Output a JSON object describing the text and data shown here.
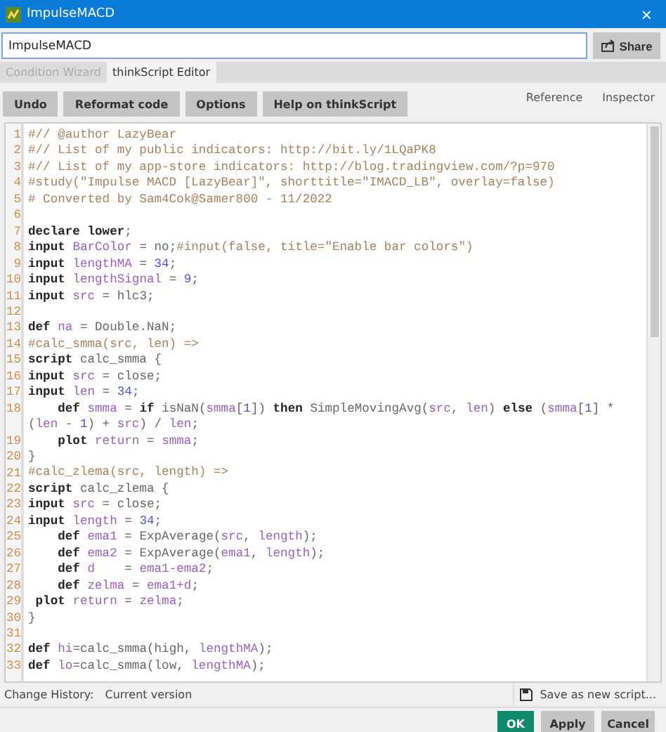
{
  "window": {
    "title": "ImpulseMACD",
    "close": "×"
  },
  "name_field": {
    "value": "ImpulseMACD"
  },
  "share_button": {
    "label": "Share"
  },
  "tabs": [
    {
      "label": "Condition Wizard",
      "selected": false
    },
    {
      "label": "thinkScript Editor",
      "selected": true
    }
  ],
  "toolbar": {
    "buttons": [
      "Undo",
      "Reformat code",
      "Options",
      "Help on thinkScript"
    ],
    "links": [
      "Reference",
      "Inspector"
    ]
  },
  "editor": {
    "lines": [
      {
        "number": "1",
        "tokens": [
          {
            "kind": "comment",
            "text": "#// @author LazyBear"
          }
        ]
      },
      {
        "number": "2",
        "tokens": [
          {
            "kind": "comment",
            "text": "#// List of my public indicators: http://bit.ly/1LQaPK8"
          }
        ]
      },
      {
        "number": "3",
        "tokens": [
          {
            "kind": "comment",
            "text": "#// List of my app-store indicators: http://blog.tradingview.com/?p=970"
          }
        ]
      },
      {
        "number": "4",
        "tokens": [
          {
            "kind": "comment",
            "text": "#study(\"Impulse MACD [LazyBear]\", shorttitle=\"IMACD_LB\", overlay=false)"
          }
        ]
      },
      {
        "number": "5",
        "tokens": [
          {
            "kind": "comment",
            "text": "# Converted by Sam4Cok@Samer800 - 11/2022"
          }
        ]
      },
      {
        "number": "6"
      },
      {
        "number": "7",
        "tokens": [
          {
            "kind": "keyword",
            "text": "declare lower"
          },
          {
            "kind": "plain",
            "text": ";"
          }
        ]
      },
      {
        "number": "8",
        "tokens": [
          {
            "kind": "keyword",
            "text": "input "
          },
          {
            "kind": "ident",
            "text": "BarColor"
          },
          {
            "kind": "plain",
            "text": " = no;"
          },
          {
            "kind": "comment",
            "text": "#input(false, title=\"Enable bar colors\")"
          }
        ]
      },
      {
        "number": "9",
        "tokens": [
          {
            "kind": "keyword",
            "text": "input "
          },
          {
            "kind": "ident",
            "text": "lengthMA"
          },
          {
            "kind": "plain",
            "text": " = "
          },
          {
            "kind": "number",
            "text": "34"
          },
          {
            "kind": "plain",
            "text": ";"
          }
        ]
      },
      {
        "number": "10",
        "tokens": [
          {
            "kind": "keyword",
            "text": "input "
          },
          {
            "kind": "ident",
            "text": "lengthSignal"
          },
          {
            "kind": "plain",
            "text": " = "
          },
          {
            "kind": "number",
            "text": "9"
          },
          {
            "kind": "plain",
            "text": ";"
          }
        ]
      },
      {
        "number": "11",
        "tokens": [
          {
            "kind": "keyword",
            "text": "input "
          },
          {
            "kind": "ident",
            "text": "src"
          },
          {
            "kind": "plain",
            "text": " = hlc3;"
          }
        ]
      },
      {
        "number": "12"
      },
      {
        "number": "13",
        "tokens": [
          {
            "kind": "keyword",
            "text": "def "
          },
          {
            "kind": "ident",
            "text": "na"
          },
          {
            "kind": "plain",
            "text": " = Double.NaN;"
          }
        ]
      },
      {
        "number": "14",
        "tokens": [
          {
            "kind": "comment",
            "text": "#calc_smma(src, len) =>"
          }
        ]
      },
      {
        "number": "15",
        "tokens": [
          {
            "kind": "keyword",
            "text": "script "
          },
          {
            "kind": "plain",
            "text": "calc_smma {"
          }
        ]
      },
      {
        "number": "16",
        "tokens": [
          {
            "kind": "keyword",
            "text": "input "
          },
          {
            "kind": "ident",
            "text": "src"
          },
          {
            "kind": "plain",
            "text": " = close;"
          }
        ]
      },
      {
        "number": "17",
        "tokens": [
          {
            "kind": "keyword",
            "text": "input "
          },
          {
            "kind": "ident",
            "text": "len"
          },
          {
            "kind": "plain",
            "text": " = "
          },
          {
            "kind": "number",
            "text": "34"
          },
          {
            "kind": "plain",
            "text": ";"
          }
        ]
      },
      {
        "number": "18",
        "tokens": [
          {
            "kind": "keyword",
            "text": "    def "
          },
          {
            "kind": "ident",
            "text": "smma"
          },
          {
            "kind": "plain",
            "text": " = "
          },
          {
            "kind": "keyword",
            "text": "if "
          },
          {
            "kind": "plain",
            "text": "isNaN("
          },
          {
            "kind": "ident",
            "text": "smma"
          },
          {
            "kind": "plain",
            "text": "["
          },
          {
            "kind": "number",
            "text": "1"
          },
          {
            "kind": "plain",
            "text": "]) "
          },
          {
            "kind": "keyword",
            "text": "then "
          },
          {
            "kind": "plain",
            "text": "SimpleMovingAvg("
          },
          {
            "kind": "ident",
            "text": "src"
          },
          {
            "kind": "plain",
            "text": ", "
          },
          {
            "kind": "ident",
            "text": "len"
          },
          {
            "kind": "plain",
            "text": ") "
          },
          {
            "kind": "keyword",
            "text": "else "
          },
          {
            "kind": "plain",
            "text": "("
          },
          {
            "kind": "ident",
            "text": "smma"
          },
          {
            "kind": "plain",
            "text": "["
          },
          {
            "kind": "number",
            "text": "1"
          },
          {
            "kind": "plain",
            "text": "] * ("
          },
          {
            "kind": "ident",
            "text": "len"
          },
          {
            "kind": "plain",
            "text": " - "
          },
          {
            "kind": "number",
            "text": "1"
          },
          {
            "kind": "plain",
            "text": ") + "
          },
          {
            "kind": "ident",
            "text": "src"
          },
          {
            "kind": "plain",
            "text": ") / "
          },
          {
            "kind": "ident",
            "text": "len"
          },
          {
            "kind": "plain",
            "text": ";"
          }
        ]
      },
      {
        "number": "19",
        "tokens": [
          {
            "kind": "keyword",
            "text": "    plot "
          },
          {
            "kind": "ident",
            "text": "return"
          },
          {
            "kind": "plain",
            "text": " = "
          },
          {
            "kind": "ident",
            "text": "smma"
          },
          {
            "kind": "plain",
            "text": ";"
          }
        ]
      },
      {
        "number": "20",
        "tokens": [
          {
            "kind": "plain",
            "text": "}"
          }
        ]
      },
      {
        "number": "21",
        "tokens": [
          {
            "kind": "comment",
            "text": "#calc_zlema(src, length) =>"
          }
        ]
      },
      {
        "number": "22",
        "tokens": [
          {
            "kind": "keyword",
            "text": "script "
          },
          {
            "kind": "plain",
            "text": "calc_zlema {"
          }
        ]
      },
      {
        "number": "23",
        "tokens": [
          {
            "kind": "keyword",
            "text": "input "
          },
          {
            "kind": "ident",
            "text": "src"
          },
          {
            "kind": "plain",
            "text": " = close;"
          }
        ]
      },
      {
        "number": "24",
        "tokens": [
          {
            "kind": "keyword",
            "text": "input "
          },
          {
            "kind": "ident",
            "text": "length"
          },
          {
            "kind": "plain",
            "text": " = "
          },
          {
            "kind": "number",
            "text": "34"
          },
          {
            "kind": "plain",
            "text": ";"
          }
        ]
      },
      {
        "number": "25",
        "tokens": [
          {
            "kind": "keyword",
            "text": "    def "
          },
          {
            "kind": "ident",
            "text": "ema1"
          },
          {
            "kind": "plain",
            "text": " = ExpAverage("
          },
          {
            "kind": "ident",
            "text": "src"
          },
          {
            "kind": "plain",
            "text": ", "
          },
          {
            "kind": "ident",
            "text": "length"
          },
          {
            "kind": "plain",
            "text": ");"
          }
        ]
      },
      {
        "number": "26",
        "tokens": [
          {
            "kind": "keyword",
            "text": "    def "
          },
          {
            "kind": "ident",
            "text": "ema2"
          },
          {
            "kind": "plain",
            "text": " = ExpAverage("
          },
          {
            "kind": "ident",
            "text": "ema1"
          },
          {
            "kind": "plain",
            "text": ", "
          },
          {
            "kind": "ident",
            "text": "length"
          },
          {
            "kind": "plain",
            "text": ");"
          }
        ]
      },
      {
        "number": "27",
        "tokens": [
          {
            "kind": "keyword",
            "text": "    def "
          },
          {
            "kind": "ident",
            "text": "d"
          },
          {
            "kind": "plain",
            "text": "    = "
          },
          {
            "kind": "ident",
            "text": "ema1-ema2"
          },
          {
            "kind": "plain",
            "text": ";"
          }
        ]
      },
      {
        "number": "28",
        "tokens": [
          {
            "kind": "keyword",
            "text": "    def "
          },
          {
            "kind": "ident",
            "text": "zelma"
          },
          {
            "kind": "plain",
            "text": " = "
          },
          {
            "kind": "ident",
            "text": "ema1+d"
          },
          {
            "kind": "plain",
            "text": ";"
          }
        ]
      },
      {
        "number": "29",
        "tokens": [
          {
            "kind": "keyword",
            "text": " plot "
          },
          {
            "kind": "ident",
            "text": "return"
          },
          {
            "kind": "plain",
            "text": " = "
          },
          {
            "kind": "ident",
            "text": "zelma"
          },
          {
            "kind": "plain",
            "text": ";"
          }
        ]
      },
      {
        "number": "30",
        "tokens": [
          {
            "kind": "plain",
            "text": "}"
          }
        ]
      },
      {
        "number": "31"
      },
      {
        "number": "32",
        "tokens": [
          {
            "kind": "keyword",
            "text": "def "
          },
          {
            "kind": "ident",
            "text": "hi"
          },
          {
            "kind": "plain",
            "text": "=calc_smma(high, "
          },
          {
            "kind": "ident",
            "text": "lengthMA"
          },
          {
            "kind": "plain",
            "text": ");"
          }
        ]
      },
      {
        "number": "33",
        "tokens": [
          {
            "kind": "keyword",
            "text": "def "
          },
          {
            "kind": "ident",
            "text": "lo"
          },
          {
            "kind": "plain",
            "text": "=calc_smma(low, "
          },
          {
            "kind": "ident",
            "text": "lengthMA"
          },
          {
            "kind": "plain",
            "text": ");"
          }
        ]
      }
    ]
  },
  "change_history": {
    "label": "Change History:",
    "value": "Current version"
  },
  "save_as_button": {
    "label": "Save as new script..."
  },
  "footer_buttons": [
    {
      "label": "OK",
      "kind": "primary"
    },
    {
      "label": "Apply",
      "kind": "secondary"
    },
    {
      "label": "Cancel",
      "kind": "secondary"
    }
  ]
}
